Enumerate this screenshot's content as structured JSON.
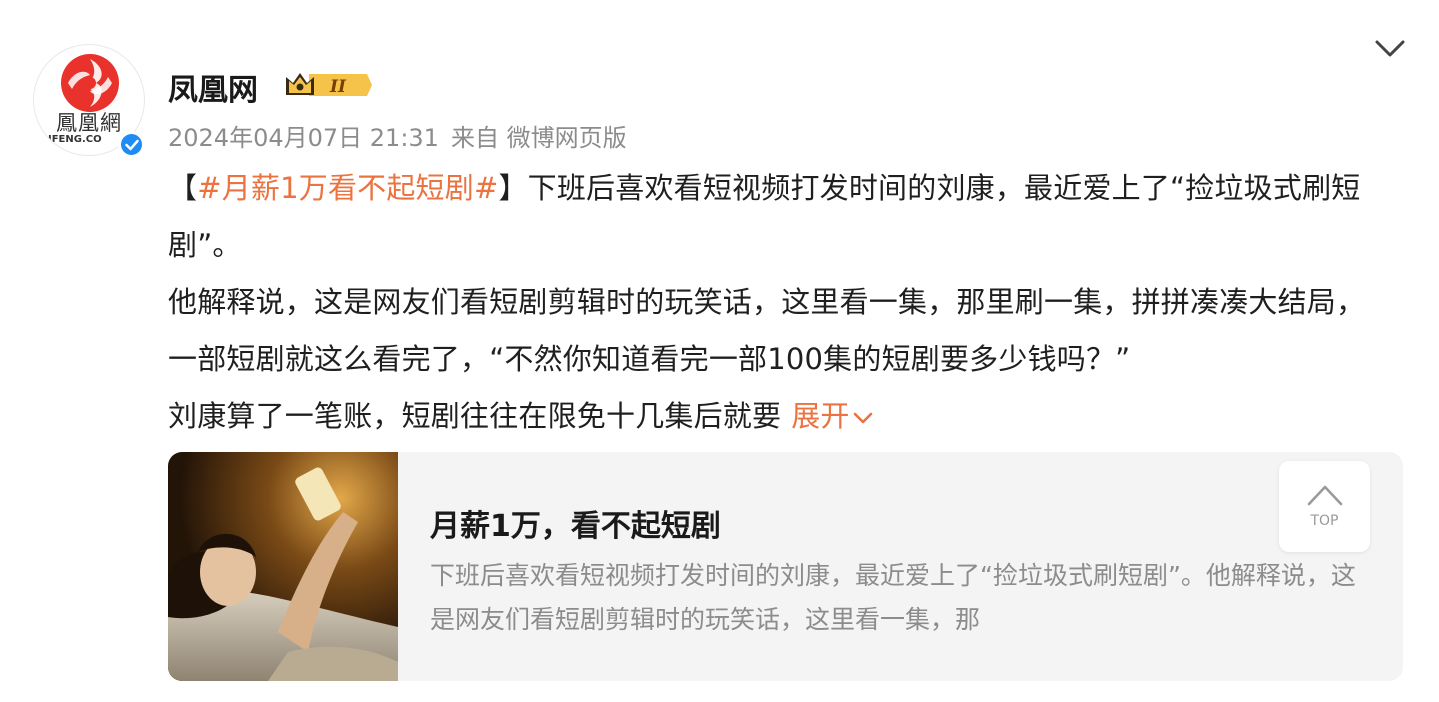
{
  "author": {
    "name": "凤凰网",
    "avatar_text_cn": "鳳凰網",
    "avatar_text_en": "IFENG.CO",
    "badge_label": "II",
    "verified_icon": "verified-check-icon"
  },
  "meta": {
    "timestamp": "2024年04月07日 21:31",
    "source": "来自 微博网页版"
  },
  "post": {
    "bracket_open": "【",
    "hashtag": "#月薪1万看不起短剧#",
    "bracket_close": "】",
    "p1_text": "下班后喜欢看短视频打发时间的刘康，最近爱上了“捡垃圾式刷短剧”。",
    "p2_text": "他解释说，这是网友们看短剧剪辑时的玩笑话，这里看一集，那里刷一集，拼拼凑凑大结局，一部短剧就这么看完了，“不然你知道看完一部100集的短剧要多少钱吗？”",
    "p3_text": "刘康算了一笔账，短剧往往在限免十几集后就要",
    "expand_label": "展开"
  },
  "card": {
    "title": "月薪1万，看不起短剧",
    "description": "下班后喜欢看短视频打发时间的刘康，最近爱上了“捡垃圾式刷短剧”。他解释说，这是网友们看短剧剪辑时的玩笑话，这里看一集，那"
  },
  "top_button": {
    "label": "TOP"
  },
  "colors": {
    "accent": "#eb7340",
    "meta_gray": "#8c8c8c",
    "card_bg": "#f4f4f4",
    "verified_blue": "#1f8bf5",
    "logo_red": "#e8322b"
  }
}
